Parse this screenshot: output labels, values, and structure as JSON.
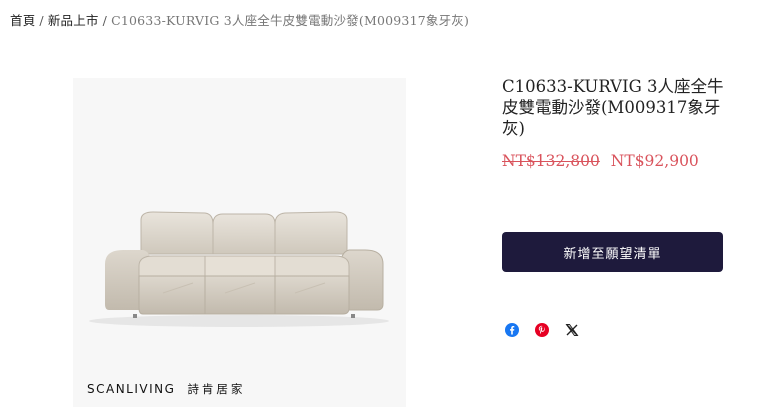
{
  "breadcrumb": {
    "home": "首頁",
    "category": "新品上市",
    "current": "C10633-KURVIG 3人座全牛皮雙電動沙發(M009317象牙灰)",
    "separator": "/"
  },
  "product": {
    "title": "C10633-KURVIG 3人座全牛皮雙電動沙發(M009317象牙灰)",
    "original_price": "NT$132,800",
    "sale_price": "NT$92,900",
    "wishlist_label": "新增至願望清單"
  },
  "brand": {
    "name": "SCANLIVING",
    "chinese": "詩肯居家"
  },
  "share": {
    "icons": [
      "facebook-icon",
      "pinterest-icon",
      "x-icon"
    ]
  },
  "colors": {
    "price": "#d9535c",
    "button": "#1e1a3c",
    "facebook": "#1877f2",
    "pinterest": "#e60023"
  }
}
